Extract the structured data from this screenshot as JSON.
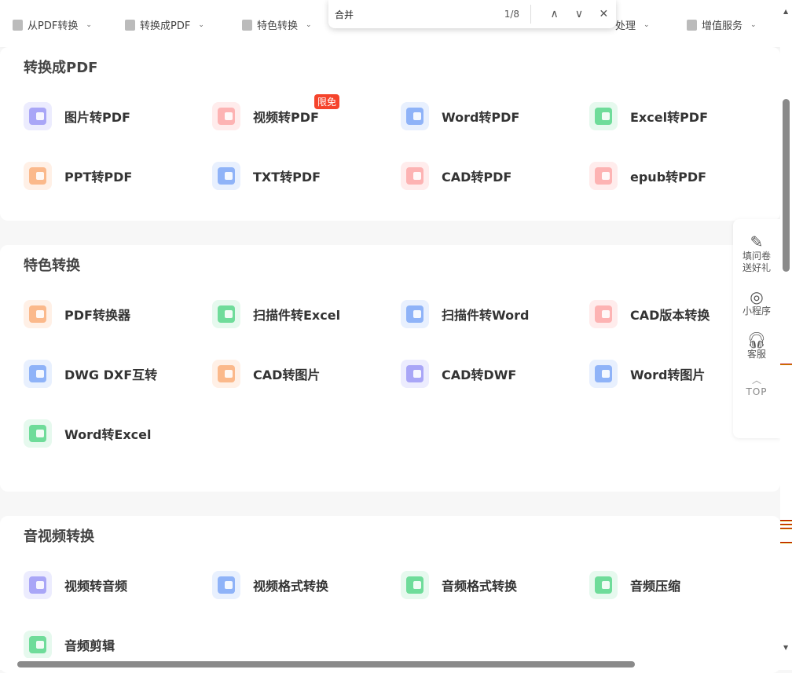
{
  "nav": [
    "从PDF转换",
    "转换成PDF",
    "特色转换",
    "处理",
    "增值服务"
  ],
  "find": {
    "query": "合并",
    "count": "1/8",
    "prev": "∧",
    "next": "∨",
    "close": "✕"
  },
  "sections": [
    {
      "title": "转换成PDF",
      "items": [
        {
          "label": "图片转PDF",
          "color": "#a9a6f7",
          "bg": "#ececfe"
        },
        {
          "label": "视频转PDF",
          "color": "#fdb3b3",
          "bg": "#ffecec",
          "badge": "限免"
        },
        {
          "label": "Word转PDF",
          "color": "#8fb3f8",
          "bg": "#e8f0fe"
        },
        {
          "label": "Excel转PDF",
          "color": "#6fdc9a",
          "bg": "#e6f9ee"
        },
        {
          "label": "PPT转PDF",
          "color": "#fbb98b",
          "bg": "#fff0e6"
        },
        {
          "label": "TXT转PDF",
          "color": "#8fb3f8",
          "bg": "#e8f0fe"
        },
        {
          "label": "CAD转PDF",
          "color": "#fdb3b3",
          "bg": "#ffecec"
        },
        {
          "label": "epub转PDF",
          "color": "#fdb3b3",
          "bg": "#ffecec"
        }
      ]
    },
    {
      "title": "特色转换",
      "items": [
        {
          "label": "PDF转换器",
          "color": "#fbb98b",
          "bg": "#fff0e6"
        },
        {
          "label": "扫描件转Excel",
          "color": "#6fdc9a",
          "bg": "#e6f9ee"
        },
        {
          "label": "扫描件转Word",
          "color": "#8fb3f8",
          "bg": "#e8f0fe"
        },
        {
          "label": "CAD版本转换",
          "color": "#fdb3b3",
          "bg": "#ffecec"
        },
        {
          "label": "DWG DXF互转",
          "color": "#8fb3f8",
          "bg": "#e8f0fe"
        },
        {
          "label": "CAD转图片",
          "color": "#fbb98b",
          "bg": "#fff0e6"
        },
        {
          "label": "CAD转DWF",
          "color": "#a9a6f7",
          "bg": "#ececfe"
        },
        {
          "label": "Word转图片",
          "color": "#8fb3f8",
          "bg": "#e8f0fe"
        },
        {
          "label": "Word转Excel",
          "color": "#6fdc9a",
          "bg": "#e6f9ee"
        }
      ]
    },
    {
      "title": "音视频转换",
      "items": [
        {
          "label": "视频转音频",
          "color": "#a9a6f7",
          "bg": "#ececfe"
        },
        {
          "label": "视频格式转换",
          "color": "#8fb3f8",
          "bg": "#e8f0fe"
        },
        {
          "label": "音频格式转换",
          "color": "#6fdc9a",
          "bg": "#e6f9ee"
        },
        {
          "label": "音频压缩",
          "color": "#6fdc9a",
          "bg": "#e6f9ee"
        },
        {
          "label": "音频剪辑",
          "color": "#6fdc9a",
          "bg": "#e6f9ee"
        }
      ]
    }
  ],
  "side": {
    "survey": "填问卷送好礼",
    "miniprogram": "小程序",
    "service": "客服",
    "top": "TOP"
  }
}
